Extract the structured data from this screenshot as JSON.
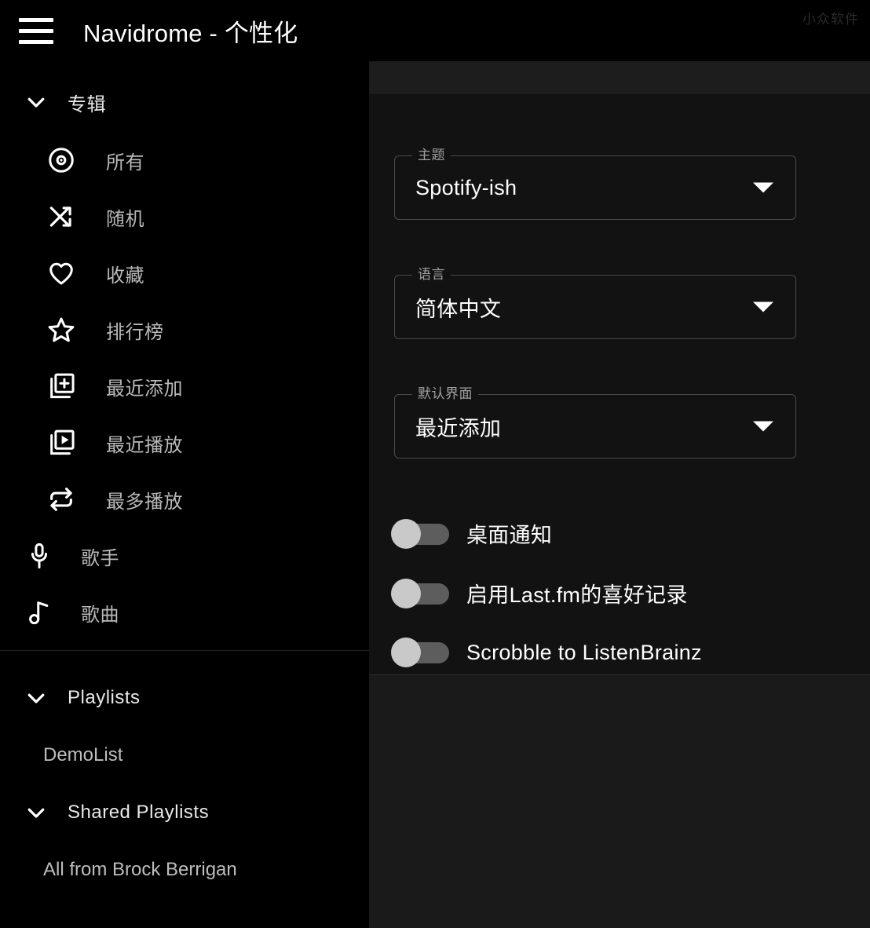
{
  "appbar": {
    "menu_icon": "hamburger-menu-icon",
    "title": "Navidrome - 个性化",
    "watermark": "小众软件"
  },
  "sidebar": {
    "groups": [
      {
        "label": "专辑",
        "expanded": true,
        "chevron_icon": "chevron-down-icon",
        "items": [
          {
            "label": "所有",
            "icon": "album-disc-icon"
          },
          {
            "label": "随机",
            "icon": "shuffle-icon"
          },
          {
            "label": "收藏",
            "icon": "heart-icon"
          },
          {
            "label": "排行榜",
            "icon": "star-icon"
          },
          {
            "label": "最近添加",
            "icon": "library-add-icon"
          },
          {
            "label": "最近播放",
            "icon": "library-play-icon"
          },
          {
            "label": "最多播放",
            "icon": "repeat-icon"
          }
        ]
      }
    ],
    "flush_items": [
      {
        "label": "歌手",
        "icon": "microphone-icon"
      },
      {
        "label": "歌曲",
        "icon": "music-note-icon"
      }
    ],
    "playlists": {
      "label": "Playlists",
      "chevron_icon": "chevron-down-icon",
      "items": [
        {
          "label": "DemoList"
        }
      ]
    },
    "shared_playlists": {
      "label": "Shared Playlists",
      "chevron_icon": "chevron-down-icon",
      "items": [
        {
          "label": "All from Brock Berrigan"
        }
      ]
    }
  },
  "settings": {
    "fields": [
      {
        "label": "主题",
        "value": "Spotify-ish",
        "icon": "caret-down-icon"
      },
      {
        "label": "语言",
        "value": "简体中文",
        "icon": "caret-down-icon"
      },
      {
        "label": "默认界面",
        "value": "最近添加",
        "icon": "caret-down-icon"
      }
    ],
    "switches": [
      {
        "label": "桌面通知",
        "checked": false
      },
      {
        "label": "启用Last.fm的喜好记录",
        "checked": false
      },
      {
        "label": "Scrobble to ListenBrainz",
        "checked": false
      }
    ]
  },
  "colors": {
    "sidebar_bg": "#000000",
    "content_bg": "#1a1a1a",
    "card_bg": "#121212",
    "text_primary": "#ffffff",
    "text_secondary": "#b9b9b9",
    "field_border": "#4a4a4a",
    "switch_track": "#5d5d5d",
    "switch_knob": "#c9c9c9",
    "watermark": "#2b2b2b"
  }
}
